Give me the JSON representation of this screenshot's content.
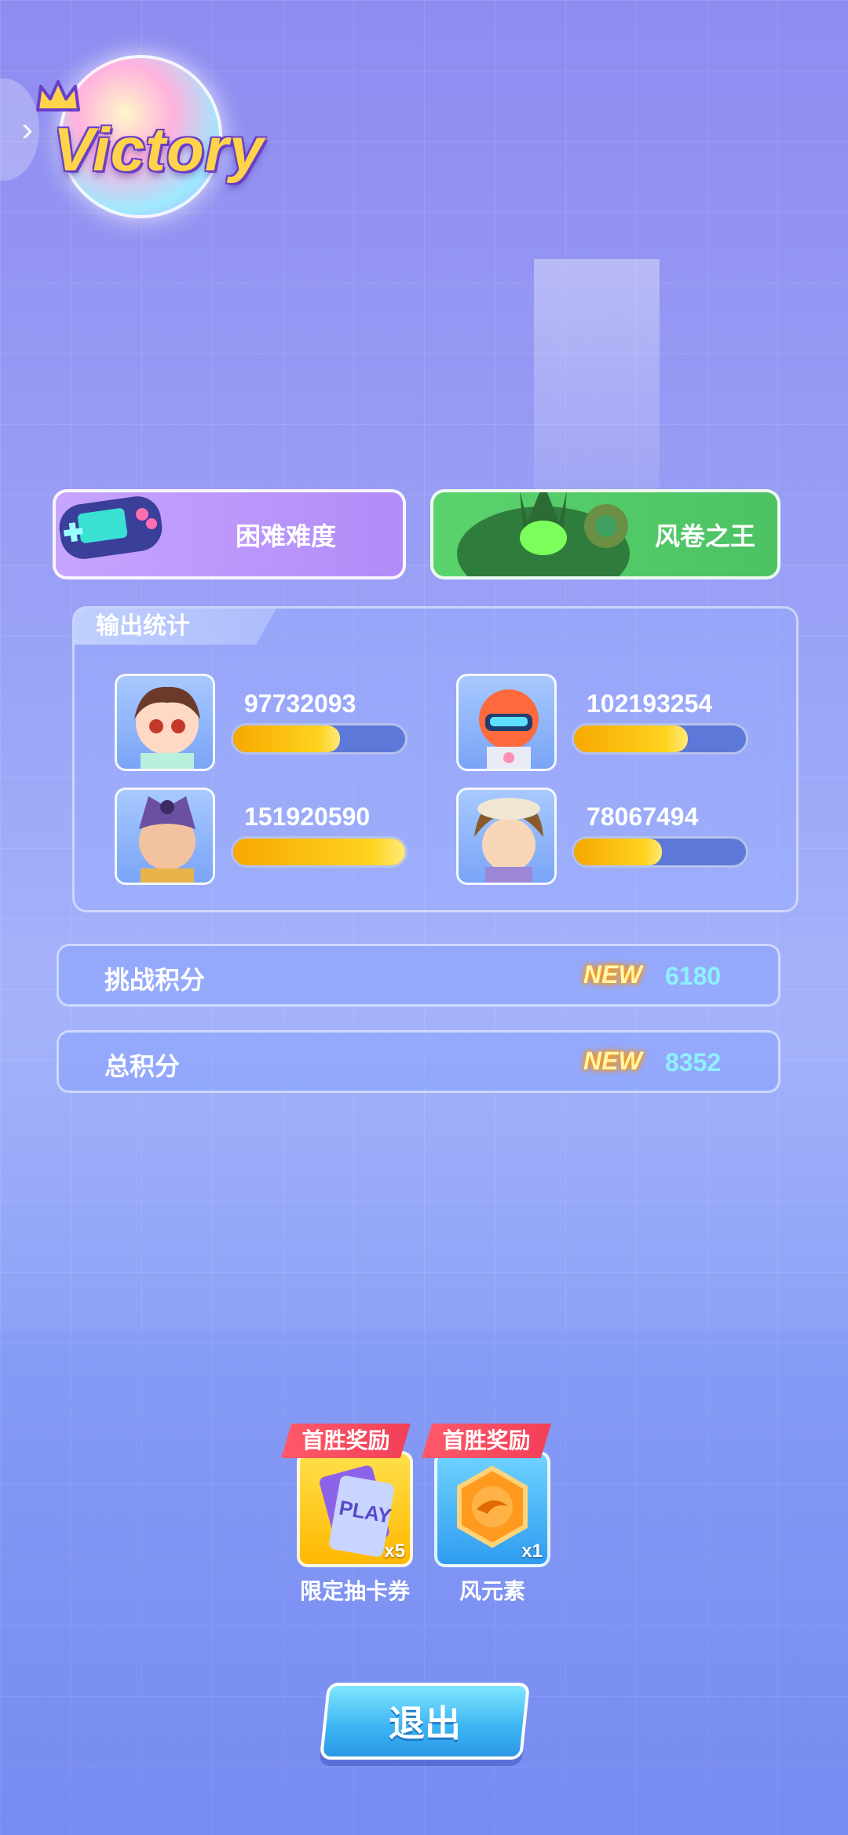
{
  "header": {
    "victory_title": "Victory"
  },
  "modes": {
    "difficulty_label": "困难难度",
    "boss_label": "风卷之王"
  },
  "stats": {
    "tab_label": "输出统计",
    "heroes": [
      {
        "name": "hero-girl",
        "damage": "97732093",
        "fill": 0.62
      },
      {
        "name": "hero-robot",
        "damage": "102193254",
        "fill": 0.66
      },
      {
        "name": "hero-warrior",
        "damage": "151920590",
        "fill": 1.0
      },
      {
        "name": "hero-cowboy",
        "damage": "78067494",
        "fill": 0.51
      }
    ]
  },
  "scores": {
    "challenge_label": "挑战积分",
    "challenge_new": "NEW",
    "challenge_value": "6180",
    "total_label": "总积分",
    "total_new": "NEW",
    "total_value": "8352"
  },
  "rewards": [
    {
      "tag": "首胜奖励",
      "name": "限定抽卡券",
      "count": "x5",
      "icon": "play-ticket-icon"
    },
    {
      "tag": "首胜奖励",
      "name": "风元素",
      "count": "x1",
      "icon": "wind-element-icon"
    }
  ],
  "exit_label": "退出",
  "colors": {
    "bar_fill": "#ffd31d",
    "score_value": "#8ef1ff",
    "reward_tag": "#f23f57",
    "exit_button": "#3bb3f2"
  }
}
